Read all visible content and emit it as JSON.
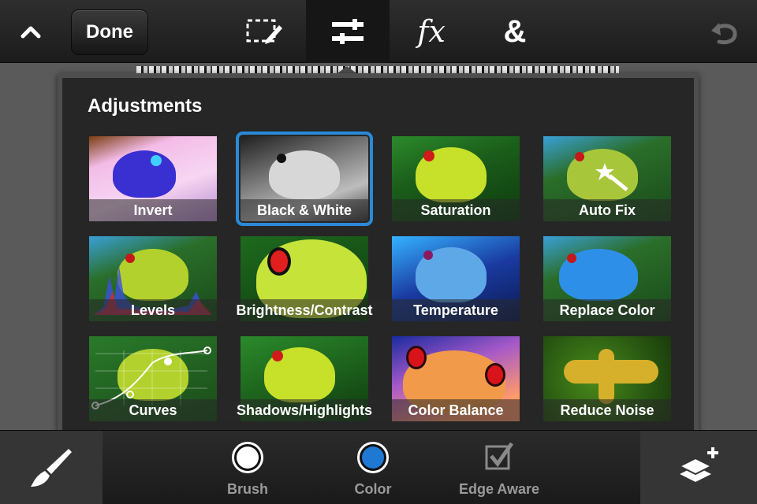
{
  "topbar": {
    "done_label": "Done",
    "tools": [
      {
        "name": "selection-tool",
        "icon": "marquee-pencil-icon"
      },
      {
        "name": "adjustments-tool",
        "icon": "sliders-icon",
        "active": true
      },
      {
        "name": "effects-tool",
        "icon": "fx-icon",
        "label": "fx"
      },
      {
        "name": "layers-combine-tool",
        "icon": "ampersand-icon",
        "label": "&"
      }
    ]
  },
  "popup": {
    "title": "Adjustments",
    "items": [
      {
        "label": "Invert"
      },
      {
        "label": "Black & White",
        "selected": true
      },
      {
        "label": "Saturation"
      },
      {
        "label": "Auto Fix"
      },
      {
        "label": "Levels"
      },
      {
        "label": "Brightness/Contrast"
      },
      {
        "label": "Temperature"
      },
      {
        "label": "Replace Color"
      },
      {
        "label": "Curves"
      },
      {
        "label": "Shadows/Highlights"
      },
      {
        "label": "Color Balance"
      },
      {
        "label": "Reduce Noise"
      }
    ]
  },
  "bottombar": {
    "brush_label": "Brush",
    "color_label": "Color",
    "edge_aware_label": "Edge Aware"
  },
  "colors": {
    "selected_accent": "#2a8ad8",
    "color_swatch": "#1f78d1"
  }
}
